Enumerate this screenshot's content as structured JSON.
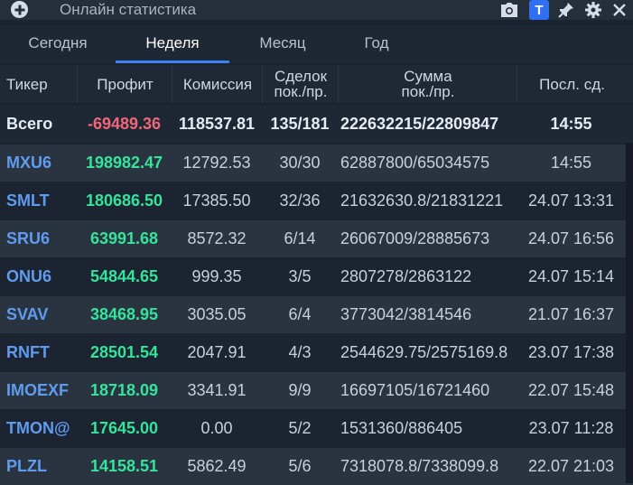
{
  "window": {
    "title": "Онлайн статистика",
    "t_button": "T"
  },
  "tabs": [
    {
      "label": "Сегодня",
      "active": false
    },
    {
      "label": "Неделя",
      "active": true
    },
    {
      "label": "Месяц",
      "active": false
    },
    {
      "label": "Год",
      "active": false
    }
  ],
  "table": {
    "headers": [
      "Тикер",
      "Профит",
      "Комиссия",
      "Сделок\nпок./пр.",
      "Сумма\nпок./пр.",
      "Посл. сд."
    ],
    "total": {
      "ticker": "Всего",
      "profit": "-69489.36",
      "commission": "118537.81",
      "deals": "135/181",
      "sum": "222632215/22809847",
      "last": "14:55"
    },
    "rows": [
      {
        "ticker": "MXU6",
        "profit": "198982.47",
        "commission": "12792.53",
        "deals": "30/30",
        "sum": "62887800/65034575",
        "last": "14:55"
      },
      {
        "ticker": "SMLT",
        "profit": "180686.50",
        "commission": "17385.50",
        "deals": "32/36",
        "sum": "21632630.8/21831221",
        "last": "24.07 13:31"
      },
      {
        "ticker": "SRU6",
        "profit": "63991.68",
        "commission": "8572.32",
        "deals": "6/14",
        "sum": "26067009/28885673",
        "last": "24.07 16:56"
      },
      {
        "ticker": "ONU6",
        "profit": "54844.65",
        "commission": "999.35",
        "deals": "3/5",
        "sum": "2807278/2863122",
        "last": "24.07 15:14"
      },
      {
        "ticker": "SVAV",
        "profit": "38468.95",
        "commission": "3035.05",
        "deals": "6/4",
        "sum": "3773042/3814546",
        "last": "21.07 16:37"
      },
      {
        "ticker": "RNFT",
        "profit": "28501.54",
        "commission": "2047.91",
        "deals": "4/3",
        "sum": "2544629.75/2575169.8",
        "last": "23.07 17:38"
      },
      {
        "ticker": "IMOEXF",
        "profit": "18718.09",
        "commission": "3341.91",
        "deals": "9/9",
        "sum": "16697105/16721460",
        "last": "22.07 15:48"
      },
      {
        "ticker": "TMON@",
        "profit": "17645.00",
        "commission": "0.00",
        "deals": "5/2",
        "sum": "1531360/886405",
        "last": "23.07 11:28"
      },
      {
        "ticker": "PLZL",
        "profit": "14158.51",
        "commission": "5862.49",
        "deals": "5/6",
        "sum": "7318078.8/7338099.8",
        "last": "22.07 21:03"
      }
    ]
  },
  "colors": {
    "background": "#1a2330",
    "accent": "#3c82f5",
    "profit_positive": "#35e39a",
    "profit_negative": "#f0677a",
    "ticker": "#5f9bef"
  }
}
